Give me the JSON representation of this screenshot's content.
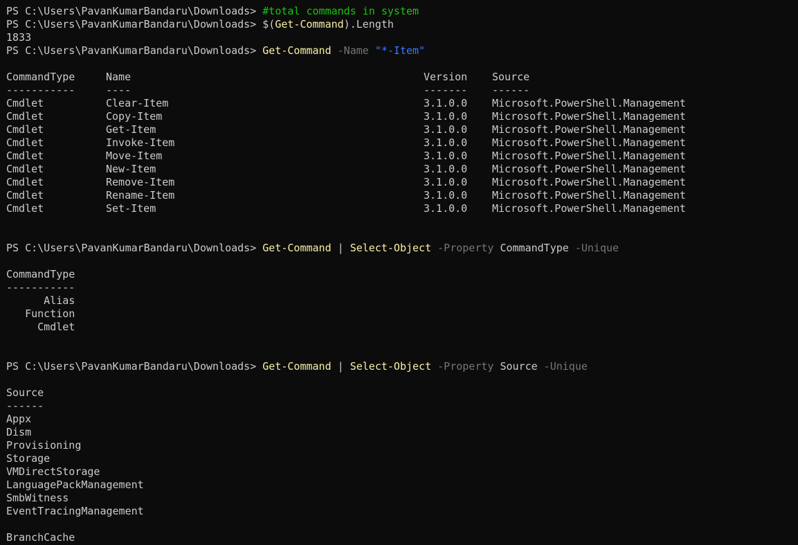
{
  "prompt": "PS C:\\Users\\PavanKumarBandaru\\Downloads> ",
  "line1": {
    "comment": "#total commands in system"
  },
  "line2": {
    "pre": "$(",
    "cmd": "Get-Command",
    "post": ").Length"
  },
  "line3": {
    "output": "1833"
  },
  "line4": {
    "cmd": "Get-Command",
    "param": "-Name",
    "string": "\"*-Item\""
  },
  "table1": {
    "headers": [
      "CommandType",
      "Name",
      "Version",
      "Source"
    ],
    "underlines": [
      "-----------",
      "----",
      "-------",
      "------"
    ],
    "rows": [
      [
        "Cmdlet",
        "Clear-Item",
        "3.1.0.0",
        "Microsoft.PowerShell.Management"
      ],
      [
        "Cmdlet",
        "Copy-Item",
        "3.1.0.0",
        "Microsoft.PowerShell.Management"
      ],
      [
        "Cmdlet",
        "Get-Item",
        "3.1.0.0",
        "Microsoft.PowerShell.Management"
      ],
      [
        "Cmdlet",
        "Invoke-Item",
        "3.1.0.0",
        "Microsoft.PowerShell.Management"
      ],
      [
        "Cmdlet",
        "Move-Item",
        "3.1.0.0",
        "Microsoft.PowerShell.Management"
      ],
      [
        "Cmdlet",
        "New-Item",
        "3.1.0.0",
        "Microsoft.PowerShell.Management"
      ],
      [
        "Cmdlet",
        "Remove-Item",
        "3.1.0.0",
        "Microsoft.PowerShell.Management"
      ],
      [
        "Cmdlet",
        "Rename-Item",
        "3.1.0.0",
        "Microsoft.PowerShell.Management"
      ],
      [
        "Cmdlet",
        "Set-Item",
        "3.1.0.0",
        "Microsoft.PowerShell.Management"
      ]
    ]
  },
  "line5": {
    "cmd1": "Get-Command",
    "pipe": " | ",
    "cmd2": "Select-Object",
    "param1": "-Property",
    "arg": "CommandType",
    "param2": "-Unique"
  },
  "table2": {
    "header": "CommandType",
    "underline": "-----------",
    "rows": [
      "      Alias",
      "   Function",
      "     Cmdlet"
    ]
  },
  "line6": {
    "cmd1": "Get-Command",
    "pipe": " | ",
    "cmd2": "Select-Object",
    "param1": "-Property",
    "arg": "Source",
    "param2": "-Unique"
  },
  "table3": {
    "header": "Source",
    "underline": "------",
    "rows": [
      "Appx",
      "Dism",
      "Provisioning",
      "Storage",
      "VMDirectStorage",
      "LanguagePackManagement",
      "SmbWitness",
      "EventTracingManagement",
      "",
      "BranchCache"
    ]
  }
}
